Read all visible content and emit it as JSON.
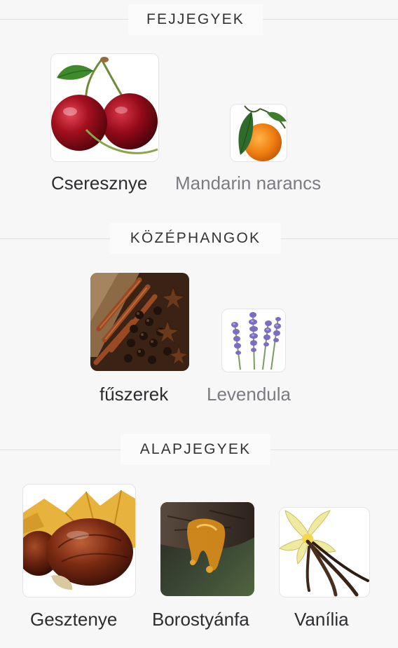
{
  "sections": [
    {
      "title": "FEJJEGYEK",
      "notes": [
        {
          "label": "Cseresznye",
          "icon": "cherry-image",
          "emphasis": "primary"
        },
        {
          "label": "Mandarin narancs",
          "icon": "mandarin-image",
          "emphasis": "secondary"
        }
      ]
    },
    {
      "title": "KÖZÉPHANGOK",
      "notes": [
        {
          "label": "fűszerek",
          "icon": "spices-image",
          "emphasis": "primary"
        },
        {
          "label": "Levendula",
          "icon": "lavender-image",
          "emphasis": "secondary"
        }
      ]
    },
    {
      "title": "ALAPJEGYEK",
      "notes": [
        {
          "label": "Gesztenye",
          "icon": "chestnut-image",
          "emphasis": "primary"
        },
        {
          "label": "Borostyánfa",
          "icon": "amber-wood-image",
          "emphasis": "primary"
        },
        {
          "label": "Vanília",
          "icon": "vanilla-image",
          "emphasis": "primary"
        }
      ]
    }
  ]
}
